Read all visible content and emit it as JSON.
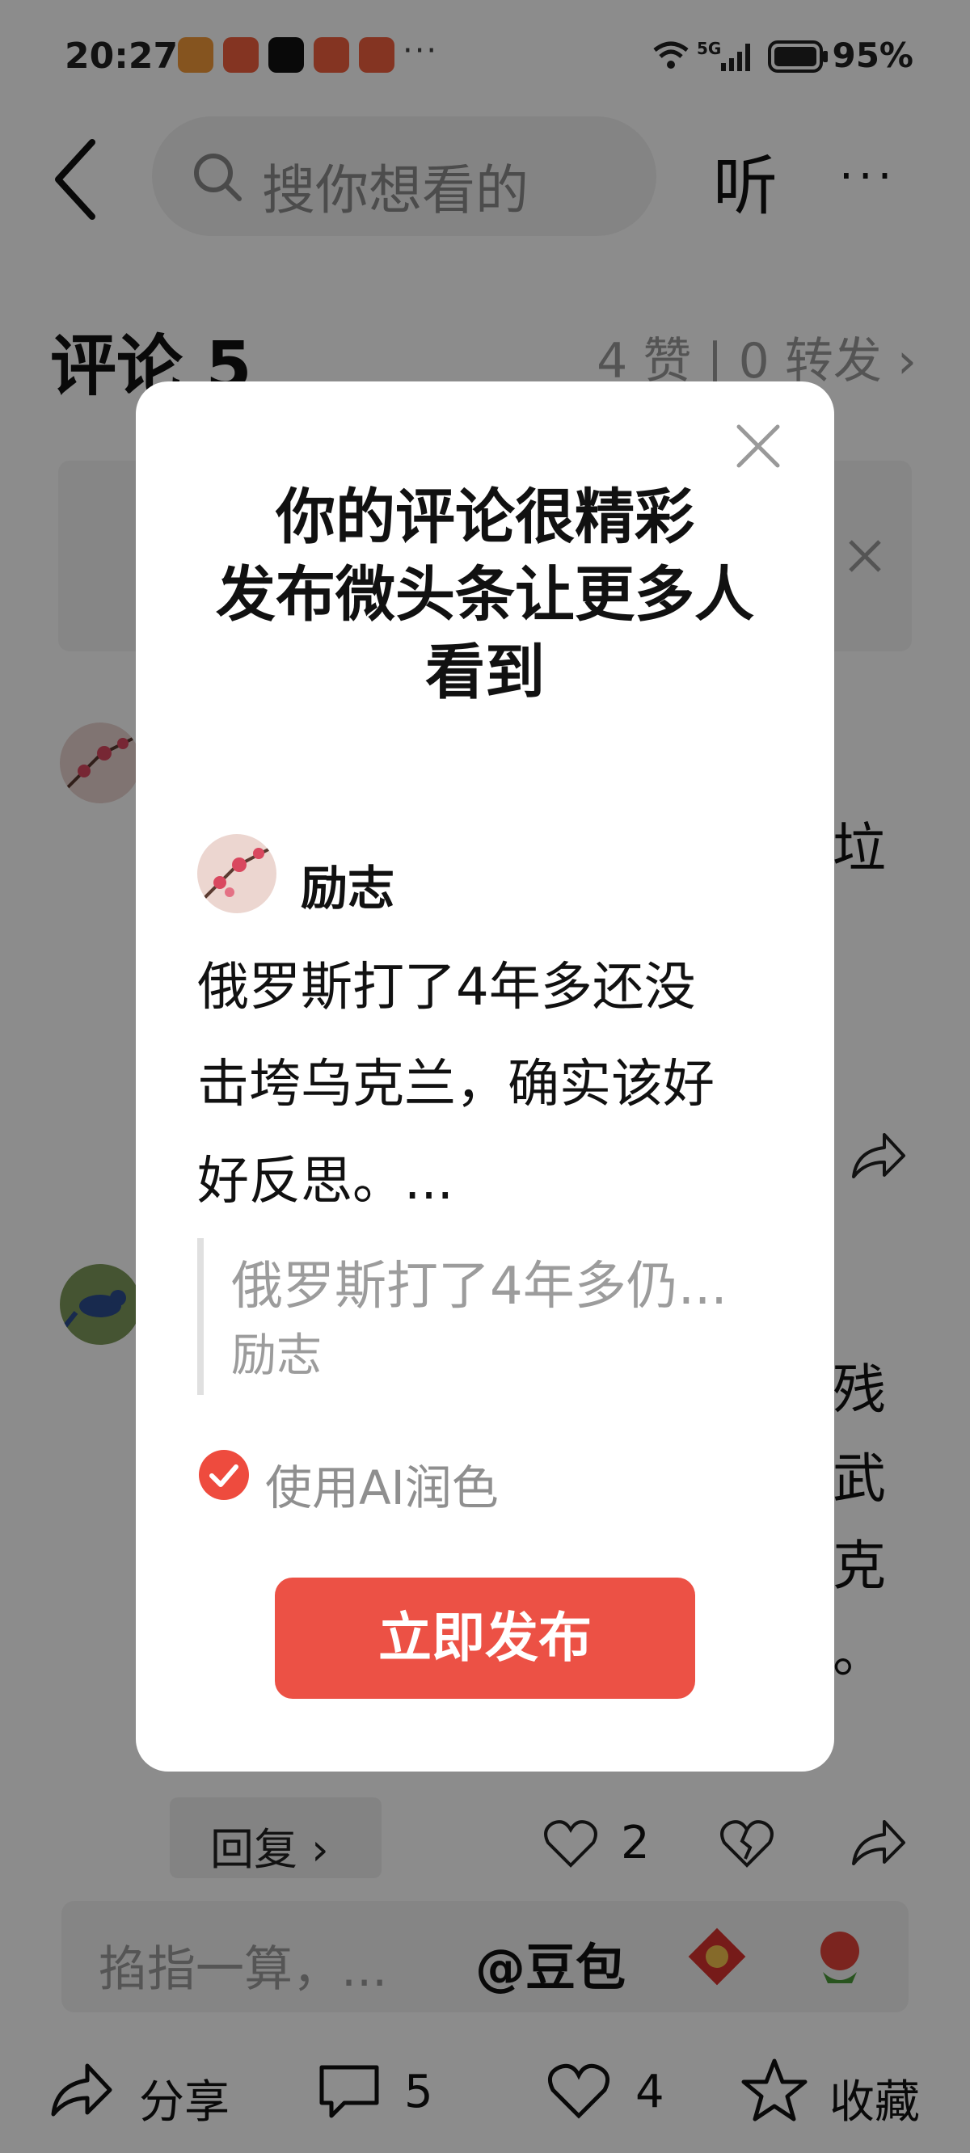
{
  "status_bar": {
    "time": "20:27",
    "more": "···",
    "network": "5G",
    "battery": "95%"
  },
  "header": {
    "search_placeholder": "搜你想看的",
    "listen_label": "听",
    "more_label": "···"
  },
  "comments": {
    "title": "评论 5",
    "stats": "4 赞 | 0 转发 ›",
    "partial_texts": [
      "垃",
      "残",
      "武",
      "克",
      "。"
    ],
    "reply_label": "回复 ›",
    "likes": "2"
  },
  "composer": {
    "placeholder": "掐指一算，...",
    "mention": "@豆包"
  },
  "bottom_bar": {
    "share": "分享",
    "comments": "5",
    "likes": "4",
    "favorite": "收藏"
  },
  "dialog": {
    "title_lines": [
      "你的评论很精彩",
      "发布微头条让更多人",
      "看到"
    ],
    "user_name": "励志",
    "body_lines": [
      "俄罗斯打了4年多还没",
      "击垮乌克兰，确实该好",
      "好反思。..."
    ],
    "quote_text": "俄罗斯打了4年多仍...",
    "quote_author": "励志",
    "ai_option": "使用AI润色",
    "ai_checked": true,
    "publish_button": "立即发布"
  },
  "colors": {
    "accent": "#ec5145",
    "overlay": "rgba(0,0,0,0.45)"
  }
}
